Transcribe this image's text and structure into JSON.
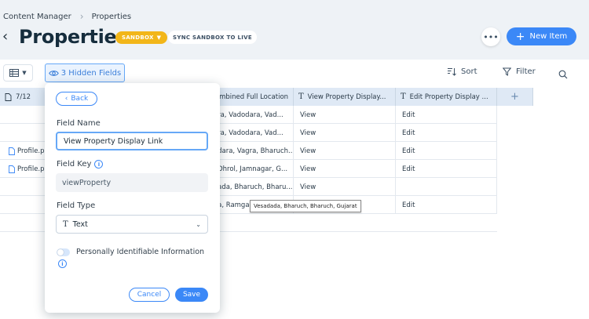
{
  "breadcrumb": {
    "items": [
      "Content Manager",
      "Properties"
    ]
  },
  "header": {
    "title": "Properties",
    "sandbox_label": "SANDBOX",
    "sync_label": "SYNC SANDBOX TO LIVE",
    "more_label": "•••",
    "new_item_label": "New Item"
  },
  "toolbar": {
    "hidden_fields_label": "3 Hidden Fields",
    "sort_label": "Sort",
    "filter_label": "Filter"
  },
  "grid": {
    "first_col_label": "7/12",
    "headers": [
      "...mbined Full Location",
      "View Property Display...",
      "Edit Property Display ..."
    ],
    "rows": [
      {
        "file": "",
        "location": "...ra, Vadodara, Vad...",
        "view": "View",
        "edit": "Edit"
      },
      {
        "file": "",
        "location": "...ra, Vadodara, Vad...",
        "view": "View",
        "edit": "Edit"
      },
      {
        "file": "Profile.p...",
        "location": "...dara, Vagra, Bharuch...",
        "view": "View",
        "edit": "Edit"
      },
      {
        "file": "Profile.p...",
        "location": "...Dhrol, Jamnagar, G...",
        "view": "View",
        "edit": "Edit"
      },
      {
        "file": "",
        "location": "...ada, Bharuch, Bharu...",
        "view": "View",
        "edit": ""
      },
      {
        "file": "",
        "location": "...a, Ramga...",
        "view": "",
        "edit": "Edit"
      }
    ],
    "tooltip": "Vesadada, Bharuch, Bharuch, Gujarat"
  },
  "popover": {
    "back_label": "Back",
    "field_name_label": "Field Name",
    "field_name_value": "View Property Display Link",
    "field_key_label": "Field Key",
    "field_key_value": "viewProperty",
    "field_type_label": "Field Type",
    "field_type_value": "Text",
    "pii_label": "Personally Identifiable Information",
    "cancel_label": "Cancel",
    "save_label": "Save"
  },
  "colors": {
    "accent": "#3b88f7",
    "sandbox": "#f2b619",
    "header_bg": "#eef2f6",
    "column_header_bg": "#dfe9f5"
  }
}
